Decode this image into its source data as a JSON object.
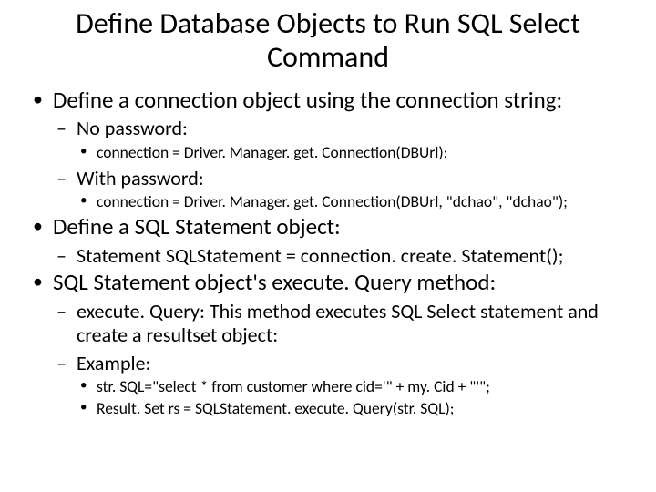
{
  "title": "Define Database Objects to Run SQL Select Command",
  "bullets": [
    {
      "text": "Define a connection object using the connection string:",
      "children": [
        {
          "text": "No password:",
          "children": [
            {
              "text": "connection = Driver. Manager. get. Connection(DBUrl);"
            }
          ]
        },
        {
          "text": "With password:",
          "children": [
            {
              "text": "connection = Driver. Manager. get. Connection(DBUrl, \"dchao\", \"dchao\");"
            }
          ]
        }
      ]
    },
    {
      "text": "Define a SQL Statement object:",
      "children": [
        {
          "text": "Statement SQLStatement = connection. create. Statement();"
        }
      ]
    },
    {
      "text": "SQL Statement object's execute. Query method:",
      "children": [
        {
          "text": "execute. Query: This method executes SQL Select statement and create a resultset object:"
        },
        {
          "text": "Example:",
          "children": [
            {
              "text": "str. SQL=\"select * from customer where cid='\" + my. Cid + \"'\";"
            },
            {
              "text": "Result. Set rs = SQLStatement. execute. Query(str. SQL);"
            }
          ]
        }
      ]
    }
  ]
}
